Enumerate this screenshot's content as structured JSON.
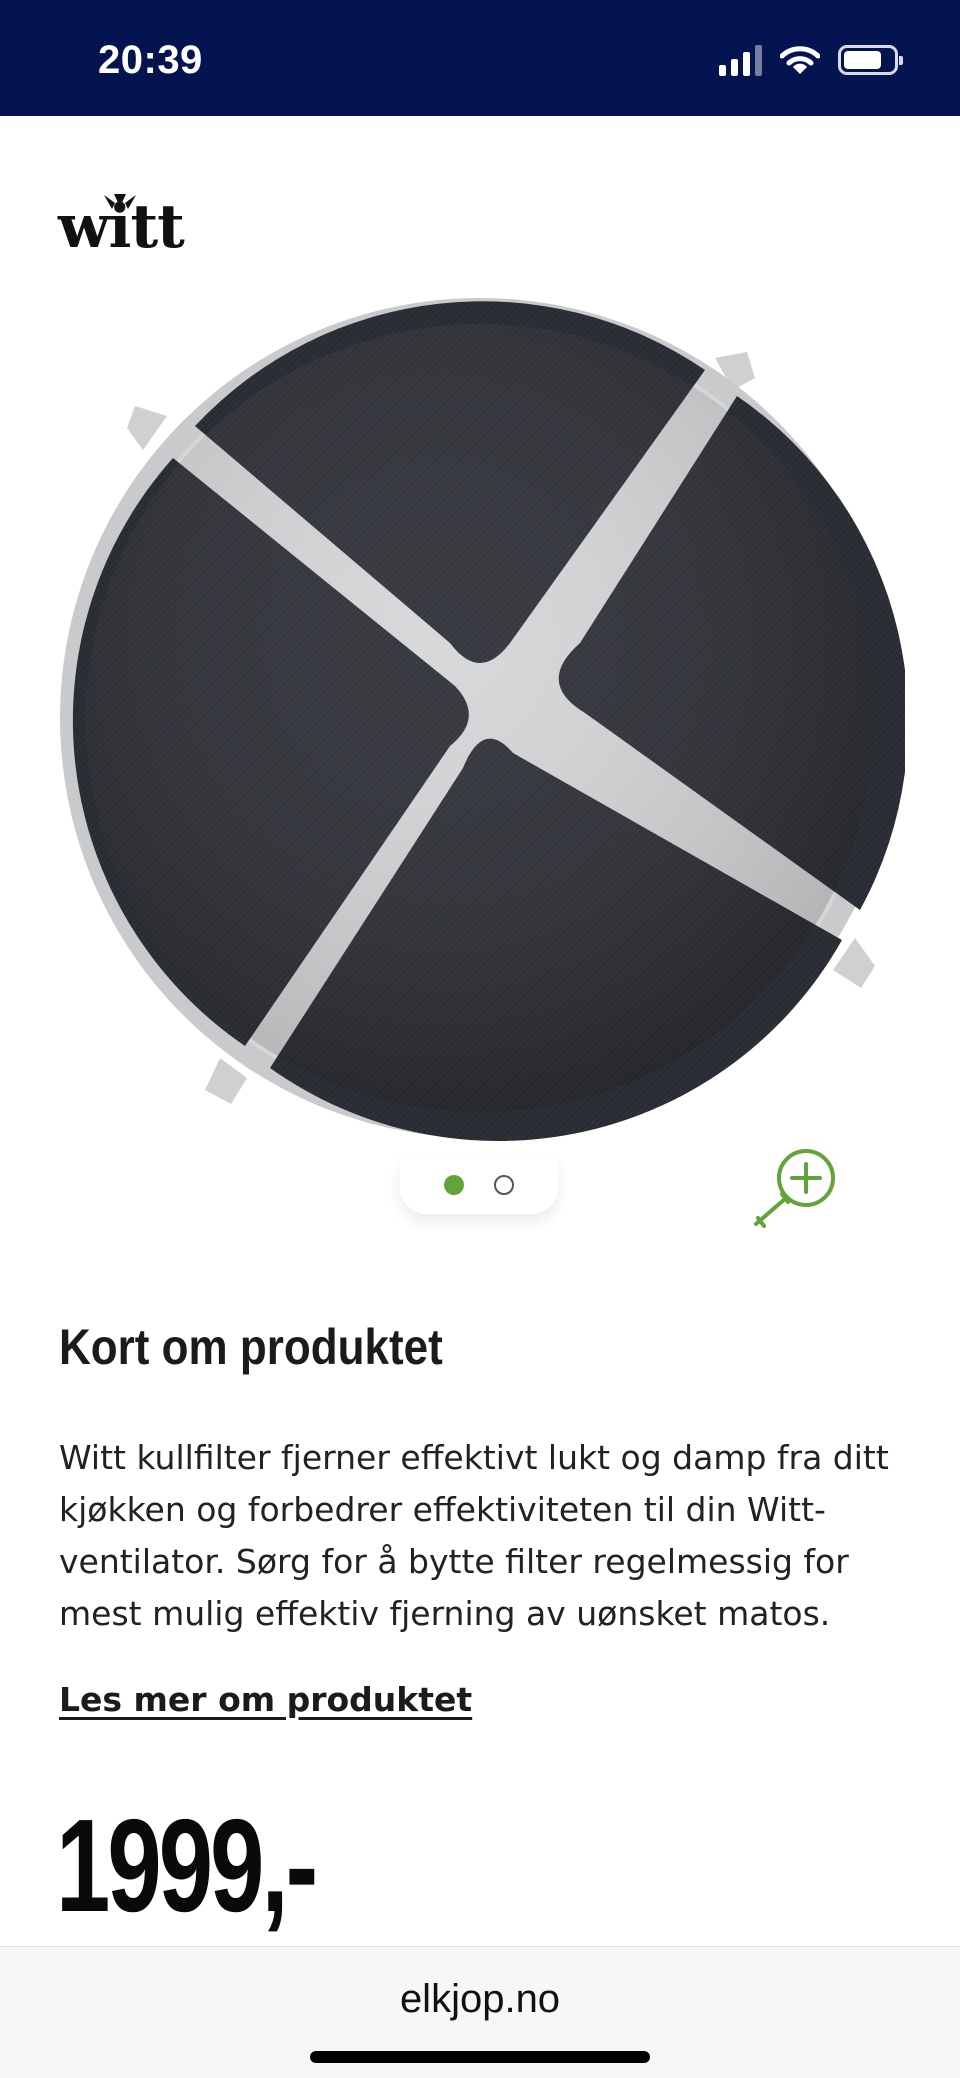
{
  "status_bar": {
    "time": "20:39",
    "signal_icon": "cellular-signal-icon",
    "wifi_icon": "wifi-icon",
    "battery_icon": "battery-icon",
    "background_color": "#041451"
  },
  "product": {
    "brand_logo_text": "witt",
    "image_icon": "carbon-filter-product-image",
    "carousel": {
      "total_images": 2,
      "active_index": 0,
      "active_color": "#63a43a"
    },
    "zoom_icon": "zoom-in-icon",
    "zoom_color": "#63a43a"
  },
  "summary": {
    "title": "Kort om produktet",
    "description": "Witt kullfilter fjerner effektivt lukt og damp fra ditt kjøkken og forbedrer effektiviteten til din Witt-ventilator. Sørg for å bytte filter regelmessig for mest mulig effektiv fjerning av uønsket matos.",
    "read_more": "Les mer om produktet"
  },
  "price": {
    "value": "1999",
    "suffix": ",-"
  },
  "browser": {
    "url": "elkjop.no"
  }
}
